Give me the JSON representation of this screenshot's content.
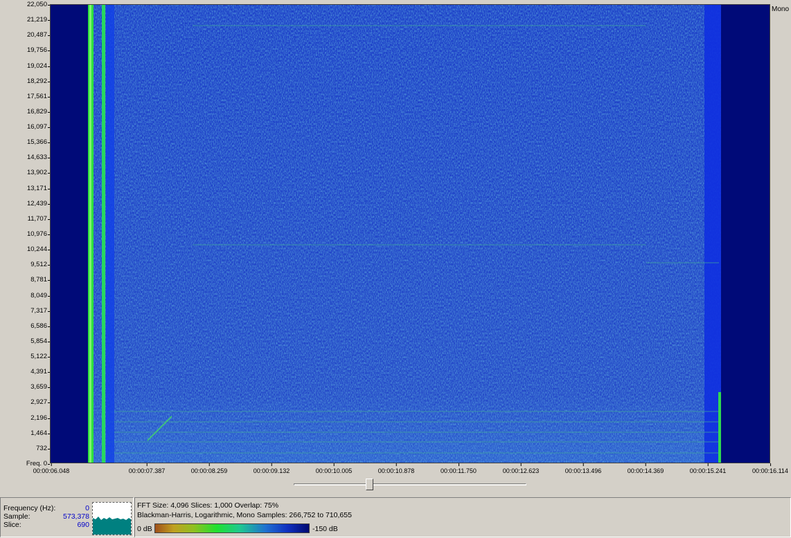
{
  "view": {
    "channel_label": "Mono",
    "colors": {
      "background_dark": "#000a78",
      "background_mid": "#1a40c0",
      "noise_light": "#2f6ad8",
      "signal_green": "#30e040",
      "harmonic_line": "#3c9c8c"
    }
  },
  "y_axis": {
    "ticks": [
      "22,050",
      "21,219",
      "20,487",
      "19,756",
      "19,024",
      "18,292",
      "17,561",
      "16,829",
      "16,097",
      "15,366",
      "14,633",
      "13,902",
      "13,171",
      "12,439",
      "11,707",
      "10,976",
      "10,244",
      "9,512",
      "8,781",
      "8,049",
      "7,317",
      "6,586",
      "5,854",
      "5,122",
      "4,391",
      "3,659",
      "2,927",
      "2,196",
      "1,464",
      "732",
      "Freq. 0"
    ]
  },
  "x_axis": {
    "ticks": [
      "00:00:06.048",
      "00:00:07.387",
      "00:00:08.259",
      "00:00:09.132",
      "00:00:10.005",
      "00:00:10.878",
      "00:00:11.750",
      "00:00:12.623",
      "00:00:13.496",
      "00:00:14.369",
      "00:00:15.241",
      "00:00:16.114"
    ]
  },
  "slider": {
    "position": 0.325
  },
  "readout": {
    "frequency_label": "Frequency (Hz):",
    "frequency_value": "0",
    "sample_label": "Sample:",
    "sample_value": "573,378",
    "slice_label": "Slice:",
    "slice_value": "690"
  },
  "info": {
    "line1": "FFT Size: 4,096  Slices: 1,000  Overlap: 75%",
    "line2": "Blackman-Harris, Logarithmic, Mono  Samples: 266,752 to 710,655",
    "scale_min": "0 dB",
    "scale_max": "-150 dB"
  }
}
